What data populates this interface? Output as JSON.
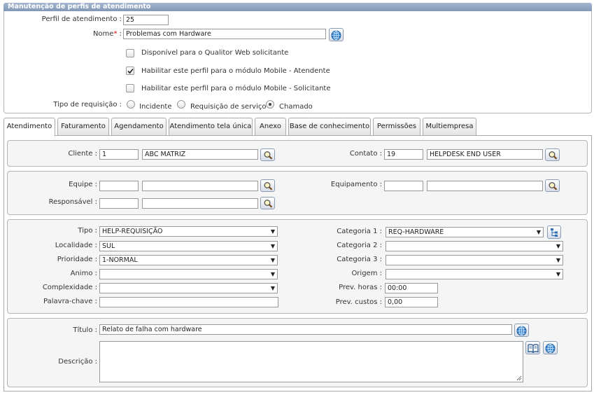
{
  "form": {
    "title": "Manutenção de perfis de atendimento",
    "perfil_label": "Perfil de atendimento :",
    "perfil_value": "25",
    "nome_label": "Nome",
    "nome_required": "*",
    "nome_colon": " :",
    "nome_value": "Problemas com Hardware",
    "check_web": {
      "label": "Disponível para o Qualitor Web solicitante",
      "checked": false
    },
    "check_mobile_atendente": {
      "label": "Habilitar este perfil para o módulo Mobile - Atendente",
      "checked": true
    },
    "check_mobile_solicitante": {
      "label": "Habilitar este perfil para o módulo Mobile - Solicitante",
      "checked": false
    },
    "tipo_req_label": "Tipo de requisição :",
    "tipo_req_options": [
      {
        "label": "Incidente",
        "selected": false
      },
      {
        "label": "Requisição de serviço",
        "selected": false
      },
      {
        "label": "Chamado",
        "selected": true
      }
    ]
  },
  "tabs": [
    {
      "label": "Atendimento",
      "active": true
    },
    {
      "label": "Faturamento",
      "active": false
    },
    {
      "label": "Agendamento",
      "active": false
    },
    {
      "label": "Atendimento tela única",
      "active": false
    },
    {
      "label": "Anexo",
      "active": false
    },
    {
      "label": "Base de conhecimento",
      "active": false
    },
    {
      "label": "Permissões",
      "active": false
    },
    {
      "label": "Multiempresa",
      "active": false
    }
  ],
  "cliente": {
    "cliente_label": "Cliente :",
    "cliente_code": "1",
    "cliente_name": "ABC MATRIZ",
    "contato_label": "Contato :",
    "contato_code": "19",
    "contato_name": "HELPDESK END USER"
  },
  "equipe": {
    "equipe_label": "Equipe :",
    "equipe_code": "",
    "equipe_name": "",
    "equipamento_label": "Equipamento :",
    "equipamento_code": "",
    "equipamento_name": "",
    "responsavel_label": "Responsável :",
    "responsavel_code": "",
    "responsavel_name": ""
  },
  "classificacao": {
    "tipo_label": "Tipo :",
    "tipo_value": "HELP-REQUISIÇÃO",
    "localidade_label": "Localidade :",
    "localidade_value": "SUL",
    "prioridade_label": "Prioridade :",
    "prioridade_value": "1-NORMAL",
    "animo_label": "Animo :",
    "animo_value": "",
    "complexidade_label": "Complexidade :",
    "complexidade_value": "",
    "palavra_label": "Palavra-chave :",
    "palavra_value": "",
    "cat1_label": "Categoria 1 :",
    "cat1_value": "REQ-HARDWARE",
    "cat2_label": "Categoria 2 :",
    "cat2_value": "",
    "cat3_label": "Categoria 3 :",
    "cat3_value": "",
    "origem_label": "Origem :",
    "origem_value": "",
    "prev_horas_label": "Prev. horas :",
    "prev_horas_value": "00:00",
    "prev_custos_label": "Prev. custos :",
    "prev_custos_value": "0,00"
  },
  "descricao": {
    "titulo_label": "Título :",
    "titulo_value": "Relato de falha com hardware",
    "descricao_label": "Descrição :",
    "descricao_value": ""
  },
  "icons": {
    "lookup": "magnifier-icon",
    "globe": "globe-icon",
    "tree": "tree-icon",
    "book": "book-icon",
    "dropdown": "chevron-down-icon"
  },
  "colors": {
    "header_bar": "#8ea3c0",
    "required": "#dd0000"
  }
}
